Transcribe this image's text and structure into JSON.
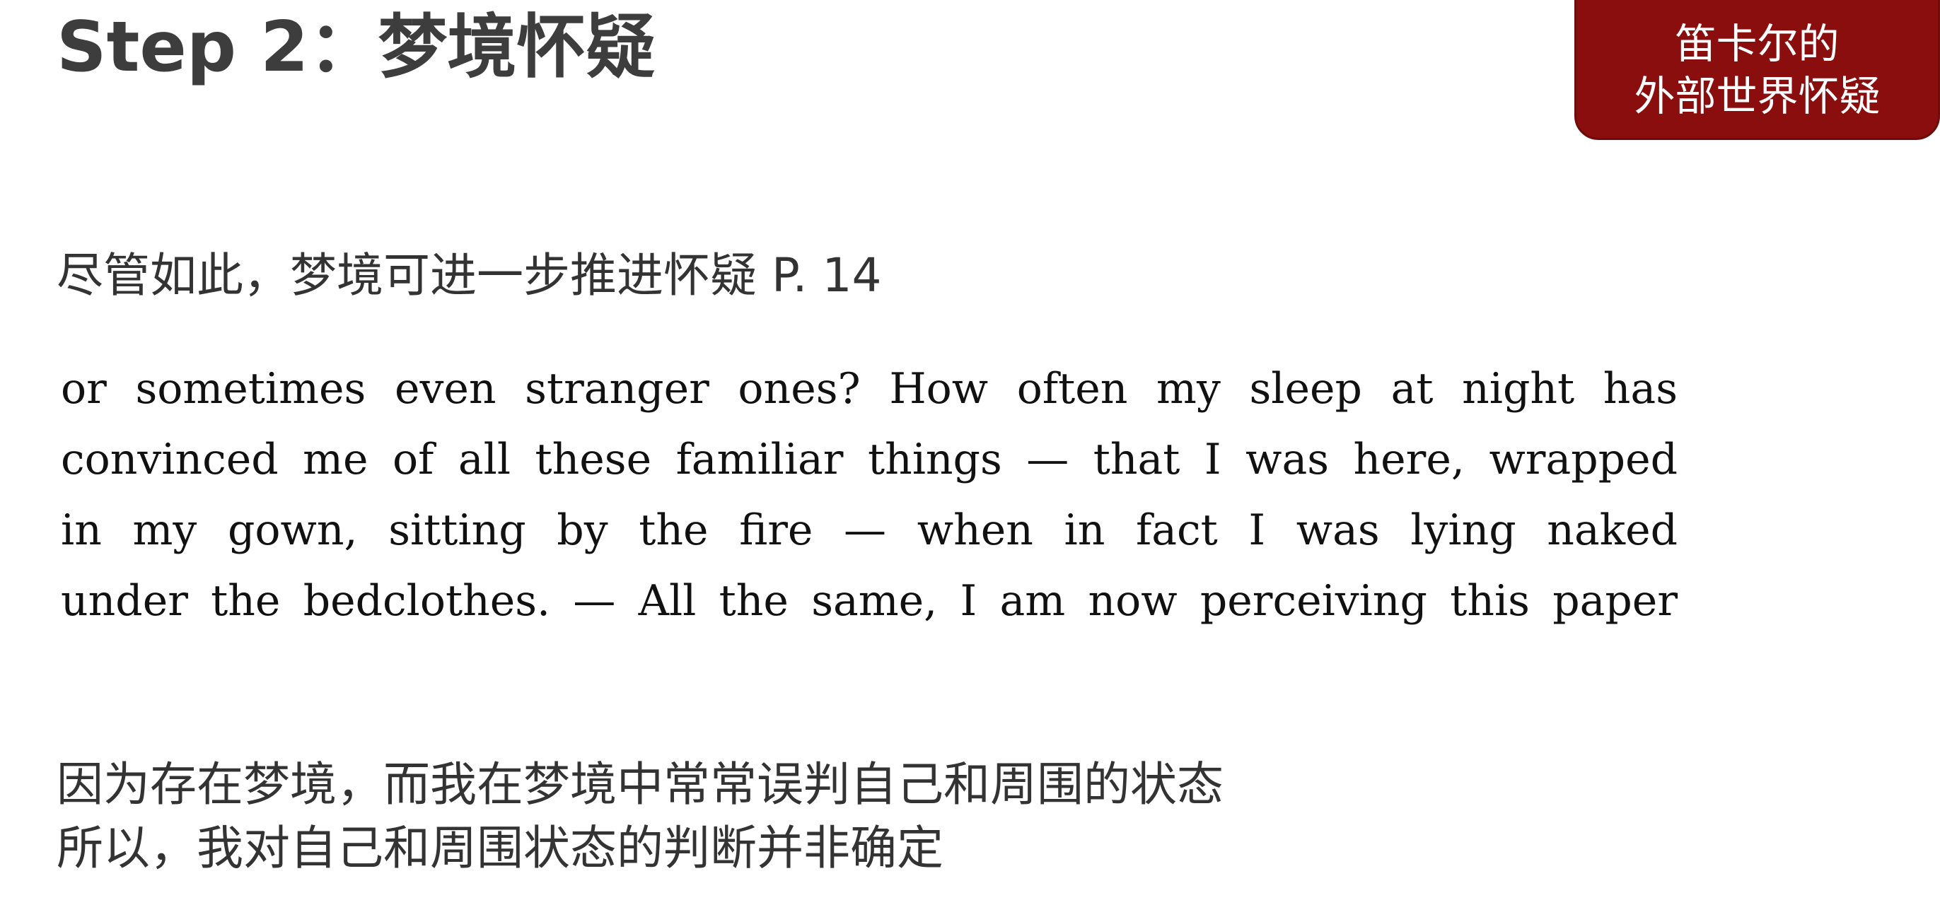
{
  "slide": {
    "title": "Step 2：梦境怀疑",
    "badge": {
      "line1": "笛卡尔的",
      "line2": "外部世界怀疑"
    },
    "intro": "尽管如此，梦境可进一步推进怀疑 P. 14",
    "quote_lines": [
      "or sometimes even stranger ones? How often my sleep at night has",
      "convinced me of all these familiar things — that I was here, wrapped",
      "in my gown, sitting by the fire — when in fact I was lying naked",
      "under the bedclothes. — All the same, I am now perceiving this paper"
    ],
    "conclusion_lines": [
      "因为存在梦境，而我在梦境中常常误判自己和周围的状态",
      "所以，我对自己和周围状态的判断并非确定"
    ]
  },
  "colors": {
    "badge_bg": "#8b0e0e",
    "title_text": "#3d3d3d",
    "body_text": "#333333",
    "quote_text": "#111111"
  }
}
